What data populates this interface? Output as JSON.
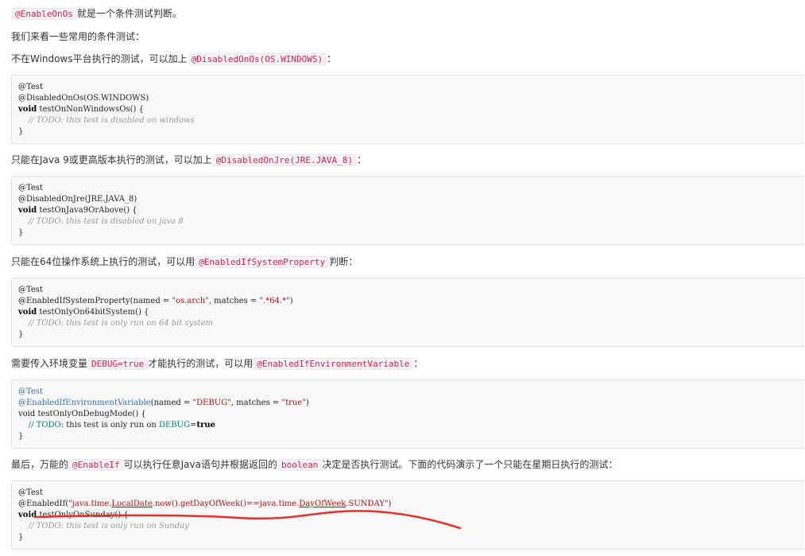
{
  "p1": {
    "code": "@EnableOnOs",
    "text": "就是一个条件测试判断。"
  },
  "p2": {
    "text": "我们来看一些常用的条件测试："
  },
  "p3": {
    "pre": "不在Windows平台执行的测试，可以加上",
    "code": "@DisabledOnOs(OS.WINDOWS)",
    "post": "："
  },
  "block1": {
    "l1": "@Test",
    "l2": "@DisabledOnOs(OS.WINDOWS)",
    "l3_kw": "void",
    "l3_rest": " testOnNonWindowsOs() {",
    "l4": "    // TODO: this test is disabled on windows",
    "l5": "}"
  },
  "p4": {
    "pre": "只能在Java 9或更高版本执行的测试，可以加上",
    "code": "@DisabledOnJre(JRE.JAVA_8)",
    "post": "："
  },
  "block2": {
    "l1": "@Test",
    "l2": "@DisabledOnJre(JRE.JAVA_8)",
    "l3_kw": "void",
    "l3_rest": " testOnJava9OrAbove() {",
    "l4": "    // TODO: this test is disabled on java 8",
    "l5": "}"
  },
  "p5": {
    "pre": "只能在64位操作系统上执行的测试，可以用",
    "code": "@EnabledIfSystemProperty",
    "post": "判断："
  },
  "block3": {
    "l1": "@Test",
    "l2a": "@EnabledIfSystemProperty(named = ",
    "l2b": "\"os.arch\"",
    "l2c": ", matches = ",
    "l2d": "\".*64.*\"",
    "l2e": ")",
    "l3_kw": "void",
    "l3_rest": " testOnlyOn64bitSystem() {",
    "l4": "    // TODO: this test is only run on 64 bit system",
    "l5": "}"
  },
  "p6": {
    "pre": "需要传入环境变量",
    "code1": "DEBUG=true",
    "mid": "才能执行的测试，可以用",
    "code2": "@EnabledIfEnvironmentVariable",
    "post": "："
  },
  "block4": {
    "l1": "@Test",
    "l2a": "@EnabledIfEnvironmentVariable",
    "l2b": "(named = ",
    "l2c": "\"DEBUG\"",
    "l2d": ", matches = ",
    "l2e": "\"true\"",
    "l2f": ")",
    "l3": "void testOnlyOnDebugMode() {",
    "l4a": "    // ",
    "l4b": "TODO",
    "l4c": ": this test is only run on ",
    "l4d": "DEBUG",
    "l4e": "=",
    "l4f": "true",
    "l5": "}"
  },
  "p7": {
    "pre": "最后，万能的",
    "code1": "@EnableIf",
    "mid1": "可以执行任意Java语句并根据返回的",
    "code2": "boolean",
    "post": "决定是否执行测试。下面的代码演示了一个只能在星期日执行的测试："
  },
  "block5": {
    "l1": "@Test",
    "l2a": "@EnabledIf(",
    "l2b": "\"java.time.",
    "l2c": "LocalDate",
    "l2d": ".now().getDayOfWeek()==java.time.",
    "l2e": "DayOfWeek",
    "l2f": ".SUNDAY\"",
    "l2g": ")",
    "l3_kw": "void",
    "l3_rest": " testOnlyOnSunday() {",
    "l4": "    // TODO: this test is only run on Sunday",
    "l5": "}"
  },
  "colors": {
    "annotation_bg": "#f9f2f4",
    "annotation_fg": "#c7254e",
    "red_mark": "#e8302a"
  }
}
